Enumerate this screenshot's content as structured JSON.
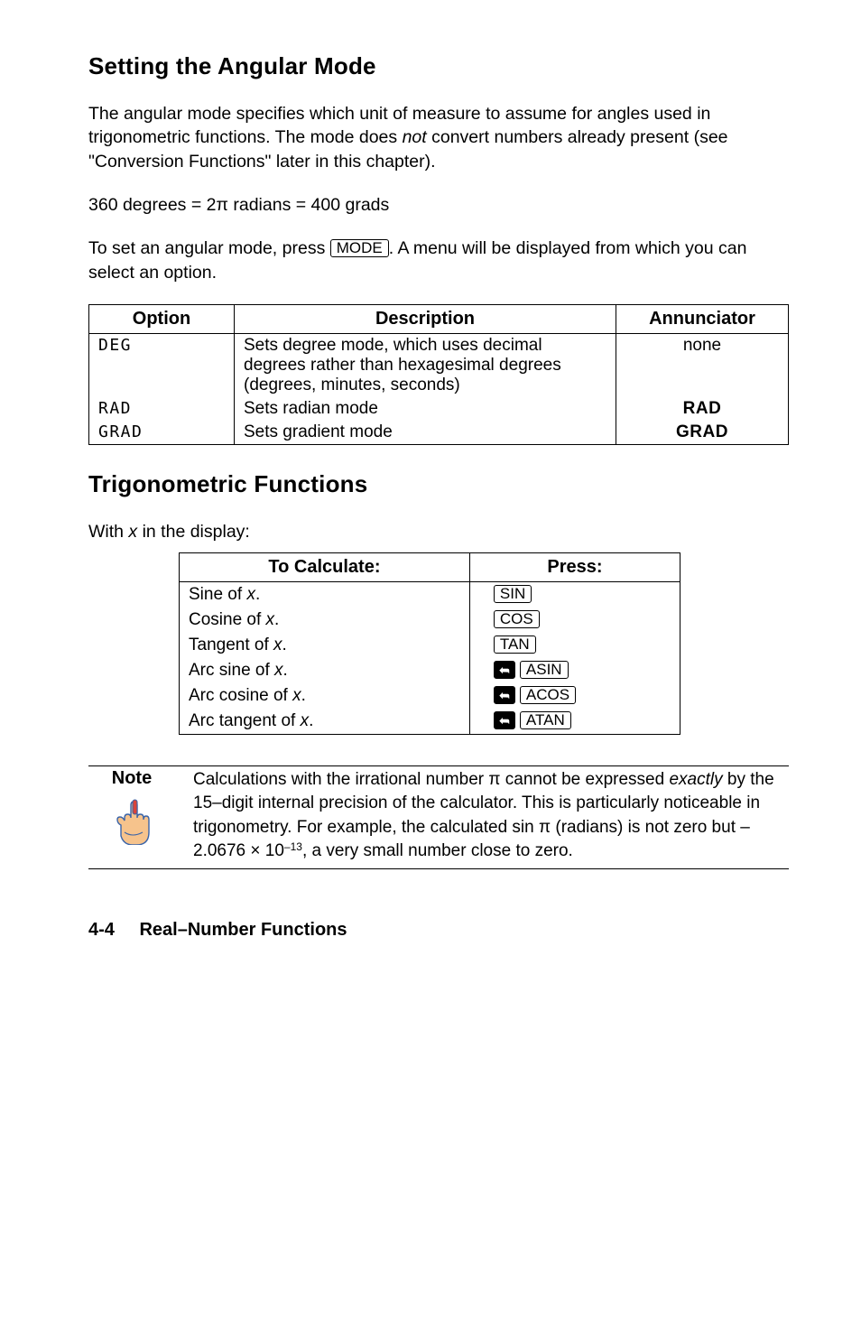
{
  "section1": {
    "title": "Setting the Angular Mode",
    "para1_a": "The angular mode specifies which unit of measure to assume for angles used in trigonometric functions. The mode does ",
    "para1_b": "not",
    "para1_c": " convert numbers already present (see \"Conversion Functions\" later in this chapter).",
    "para2": "360 degrees = 2π radians = 400 grads",
    "para3_a": "To set an angular mode, press ",
    "para3_key": "MODE",
    "para3_b": ". A menu will be displayed from which you can select an option."
  },
  "optionsTable": {
    "headers": {
      "c1": "Option",
      "c2": "Description",
      "c3": "Annunciator"
    },
    "rows": [
      {
        "opt": "DEG",
        "desc": "Sets degree mode, which uses decimal degrees rather than hexagesimal degrees (degrees, minutes, seconds)",
        "ann": "none",
        "annBold": false
      },
      {
        "opt": "RAD",
        "desc": "Sets radian mode",
        "ann": "RAD",
        "annBold": true
      },
      {
        "opt": "GRAD",
        "desc": "Sets gradient mode",
        "ann": "GRAD",
        "annBold": true
      }
    ]
  },
  "section2": {
    "title": "Trigonometric Functions",
    "lead_a": "With ",
    "lead_b": "x",
    "lead_c": " in the display:"
  },
  "trigTable": {
    "headers": {
      "c1": "To Calculate:",
      "c2": "Press:"
    },
    "rows": [
      {
        "label_a": "Sine of ",
        "label_b": "x",
        "label_c": ".",
        "shift": false,
        "key": "SIN"
      },
      {
        "label_a": "Cosine of ",
        "label_b": "x",
        "label_c": ".",
        "shift": false,
        "key": "COS"
      },
      {
        "label_a": "Tangent of ",
        "label_b": "x",
        "label_c": ".",
        "shift": false,
        "key": "TAN"
      },
      {
        "label_a": "Arc sine of ",
        "label_b": "x",
        "label_c": ".",
        "shift": true,
        "key": "ASIN"
      },
      {
        "label_a": "Arc cosine of ",
        "label_b": "x",
        "label_c": ".",
        "shift": true,
        "key": "ACOS"
      },
      {
        "label_a": "Arc tangent of ",
        "label_b": "x",
        "label_c": ".",
        "shift": true,
        "key": "ATAN"
      }
    ]
  },
  "note": {
    "label": "Note",
    "text_a": "Calculations with the irrational number π cannot be expressed ",
    "text_b": "exactly",
    "text_c": " by the 15–digit internal precision of the calculator. This is particularly noticeable in trigonometry. For example, the calculated sin π (radians) is not zero but –2.0676 × 10",
    "text_exp": "–13",
    "text_d": ", a very small number close to zero."
  },
  "footer": {
    "page": "4-4",
    "chapter": "Real–Number Functions"
  }
}
